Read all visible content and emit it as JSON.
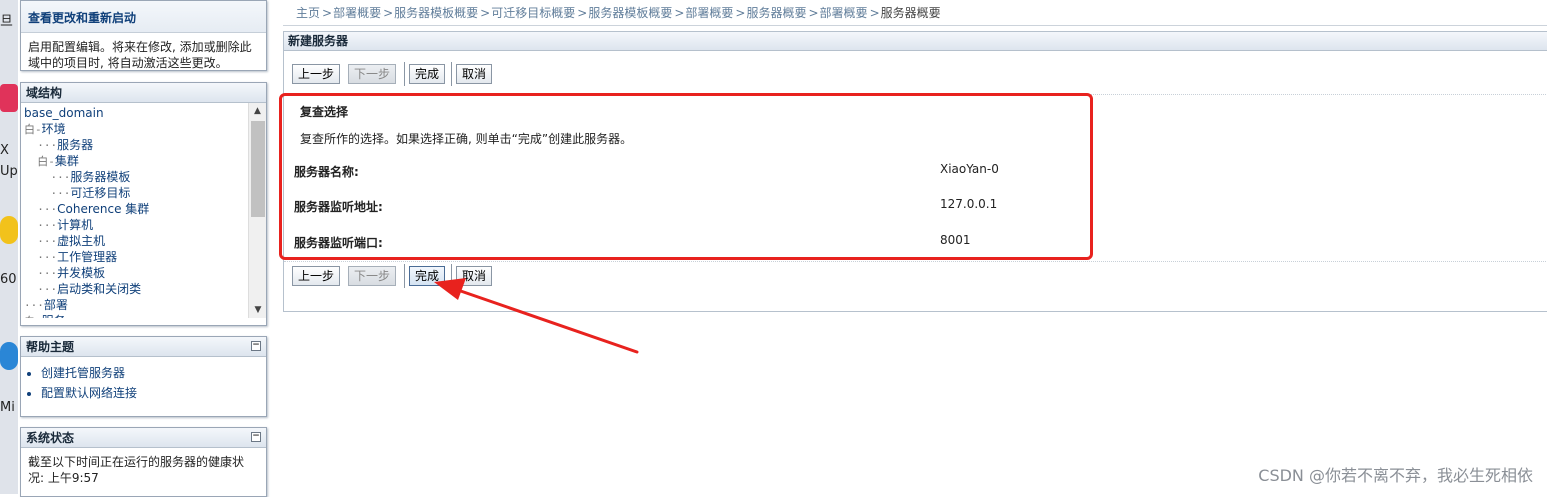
{
  "breadcrumb": {
    "items": [
      "主页",
      "部署概要",
      "服务器模板概要",
      "可迁移目标概要",
      "服务器模板概要",
      "部署概要",
      "服务器概要",
      "部署概要"
    ],
    "current": "服务器概要",
    "separator": ">"
  },
  "change_center": {
    "link": "查看更改和重新启动",
    "description": "启用配置编辑。将来在修改, 添加或删除此域中的项目时, 将自动激活这些更改。"
  },
  "domain_structure": {
    "title": "域结构",
    "root": "base_domain",
    "nodes": [
      {
        "prefix": "白-",
        "label": "环境"
      },
      {
        "prefix": "  ···",
        "label": "服务器"
      },
      {
        "prefix": "  白-",
        "label": "集群"
      },
      {
        "prefix": "    ···",
        "label": "服务器模板"
      },
      {
        "prefix": "    ···",
        "label": "可迁移目标"
      },
      {
        "prefix": "  ···",
        "label": "Coherence 集群"
      },
      {
        "prefix": "  ···",
        "label": "计算机"
      },
      {
        "prefix": "  ···",
        "label": "虚拟主机"
      },
      {
        "prefix": "  ···",
        "label": "工作管理器"
      },
      {
        "prefix": "  ···",
        "label": "并发模板"
      },
      {
        "prefix": "  ···",
        "label": "启动类和关闭类"
      },
      {
        "prefix": "···",
        "label": "部署"
      },
      {
        "prefix": "白-",
        "label": "服务"
      }
    ]
  },
  "help_topics": {
    "title": "帮助主题",
    "items": [
      "创建托管服务器",
      "配置默认网络连接"
    ]
  },
  "system_status": {
    "title": "系统状态",
    "description": "截至以下时间正在运行的服务器的健康状况: 上午9:57"
  },
  "main": {
    "title": "新建服务器",
    "buttons": {
      "back": "上一步",
      "next": "下一步",
      "finish": "完成",
      "cancel": "取消"
    },
    "review": {
      "title": "复查选择",
      "description": "复查所作的选择。如果选择正确, 则单击“完成”创建此服务器。",
      "fields": [
        {
          "label": "服务器名称:",
          "value": "XiaoYan-0"
        },
        {
          "label": "服务器监听地址:",
          "value": "127.0.0.1"
        },
        {
          "label": "服务器监听端口:",
          "value": "8001"
        }
      ]
    }
  },
  "desktop": {
    "texts": [
      "旦",
      "X",
      "Up",
      "60",
      "Mi"
    ]
  },
  "watermark": "CSDN @你若不离不弃，我必生死相依",
  "colors": {
    "link": "#10407a",
    "annotation": "#e8221e",
    "panel_border": "#9aa6b6"
  }
}
